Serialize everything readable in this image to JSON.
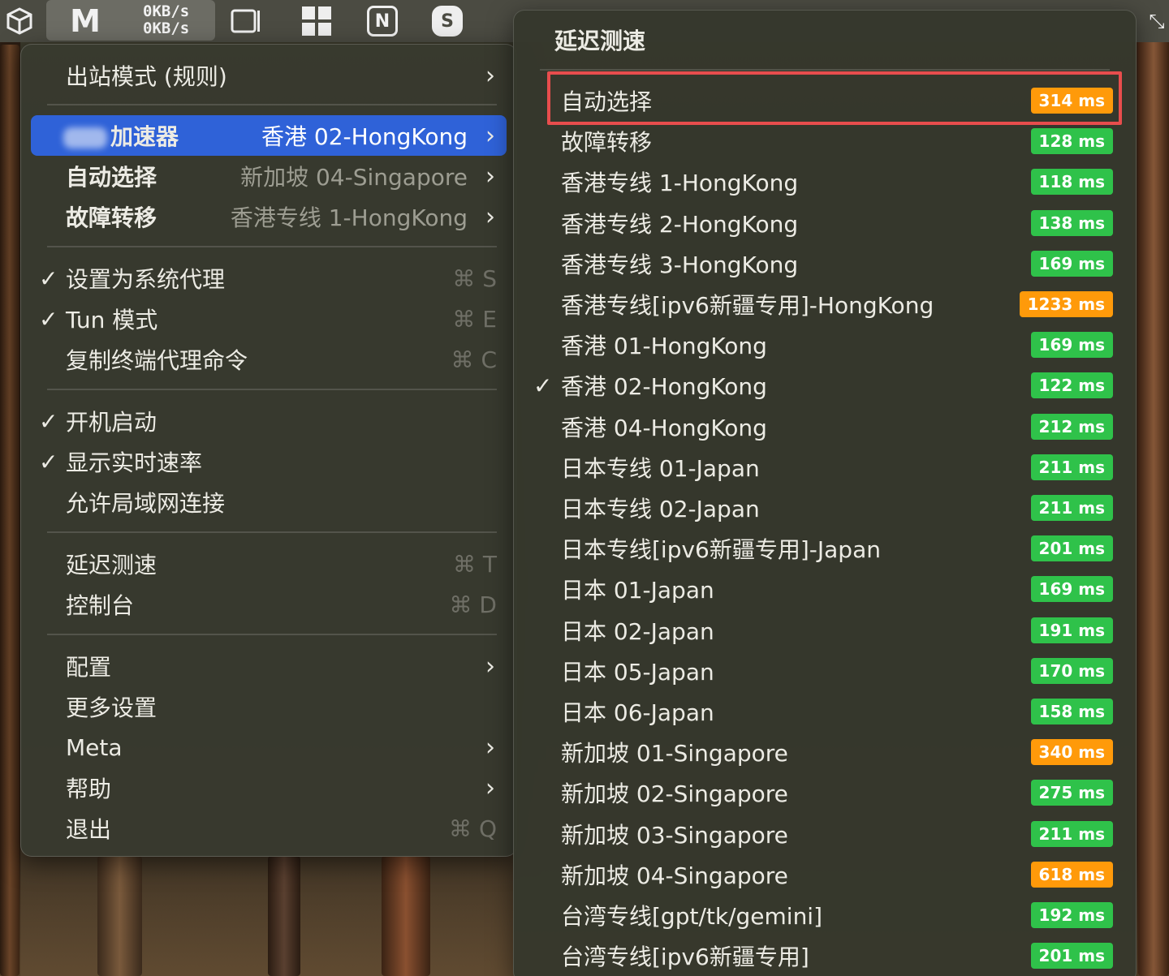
{
  "colors": {
    "green": "#2fc24a",
    "orange": "#ff9a0a",
    "selected_blue": "#2f62d8",
    "highlight_red": "#e84d4d"
  },
  "menubar": {
    "speed_up": "0KB/s",
    "speed_down": "0KB/s",
    "icons": [
      "package-icon",
      "app-m-icon",
      "sidebar-icon",
      "grid-icon",
      "notion-icon",
      "s-app-icon"
    ]
  },
  "menu": {
    "outbound_mode": "出站模式 (规则)",
    "groups": [
      {
        "label": "加速器",
        "value": "香港 02-HongKong"
      },
      {
        "label": "自动选择",
        "value": "新加坡 04-Singapore"
      },
      {
        "label": "故障转移",
        "value": "香港专线 1-HongKong"
      }
    ],
    "toggles": [
      {
        "label": "设置为系统代理",
        "checked": true,
        "shortcut": "⌘ S"
      },
      {
        "label": "Tun 模式",
        "checked": true,
        "shortcut": "⌘ E"
      },
      {
        "label": "复制终端代理命令",
        "checked": false,
        "shortcut": "⌘ C"
      }
    ],
    "options": [
      {
        "label": "开机启动",
        "checked": true
      },
      {
        "label": "显示实时速率",
        "checked": true
      },
      {
        "label": "允许局域网连接",
        "checked": false
      }
    ],
    "tools": [
      {
        "label": "延迟测速",
        "shortcut": "⌘ T"
      },
      {
        "label": "控制台",
        "shortcut": "⌘ D"
      }
    ],
    "config": "配置",
    "more_settings": "更多设置",
    "meta": "Meta",
    "help": "帮助",
    "quit": "退出",
    "quit_shortcut": "⌘ Q"
  },
  "submenu": {
    "title": "延迟测速",
    "nodes": [
      {
        "name": "自动选择",
        "latency": "314 ms",
        "status": "orange",
        "checked": false
      },
      {
        "name": "故障转移",
        "latency": "128 ms",
        "status": "green",
        "checked": false
      },
      {
        "name": "香港专线 1-HongKong",
        "latency": "118 ms",
        "status": "green",
        "checked": false
      },
      {
        "name": "香港专线 2-HongKong",
        "latency": "138 ms",
        "status": "green",
        "checked": false
      },
      {
        "name": "香港专线 3-HongKong",
        "latency": "169 ms",
        "status": "green",
        "checked": false
      },
      {
        "name": "香港专线[ipv6新疆专用]-HongKong",
        "latency": "1233 ms",
        "status": "orange",
        "checked": false
      },
      {
        "name": "香港 01-HongKong",
        "latency": "169 ms",
        "status": "green",
        "checked": false
      },
      {
        "name": "香港 02-HongKong",
        "latency": "122 ms",
        "status": "green",
        "checked": true
      },
      {
        "name": "香港 04-HongKong",
        "latency": "212 ms",
        "status": "green",
        "checked": false
      },
      {
        "name": "日本专线 01-Japan",
        "latency": "211 ms",
        "status": "green",
        "checked": false
      },
      {
        "name": "日本专线 02-Japan",
        "latency": "211 ms",
        "status": "green",
        "checked": false
      },
      {
        "name": "日本专线[ipv6新疆专用]-Japan",
        "latency": "201 ms",
        "status": "green",
        "checked": false
      },
      {
        "name": "日本 01-Japan",
        "latency": "169 ms",
        "status": "green",
        "checked": false
      },
      {
        "name": "日本 02-Japan",
        "latency": "191 ms",
        "status": "green",
        "checked": false
      },
      {
        "name": "日本 05-Japan",
        "latency": "170 ms",
        "status": "green",
        "checked": false
      },
      {
        "name": "日本 06-Japan",
        "latency": "158 ms",
        "status": "green",
        "checked": false
      },
      {
        "name": "新加坡 01-Singapore",
        "latency": "340 ms",
        "status": "orange",
        "checked": false
      },
      {
        "name": "新加坡 02-Singapore",
        "latency": "275 ms",
        "status": "green",
        "checked": false
      },
      {
        "name": "新加坡 03-Singapore",
        "latency": "211 ms",
        "status": "green",
        "checked": false
      },
      {
        "name": "新加坡 04-Singapore",
        "latency": "618 ms",
        "status": "orange",
        "checked": false
      },
      {
        "name": "台湾专线[gpt/tk/gemini]",
        "latency": "192 ms",
        "status": "green",
        "checked": false
      },
      {
        "name": "台湾专线[ipv6新疆专用]",
        "latency": "201 ms",
        "status": "green",
        "checked": false
      }
    ]
  }
}
